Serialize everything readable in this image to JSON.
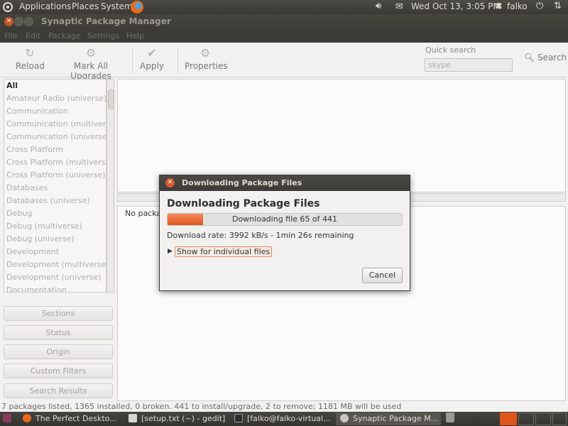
{
  "top_panel": {
    "menus": [
      "Applications",
      "Places",
      "System"
    ],
    "datetime": "Wed Oct 13,  3:05 PM",
    "user": "falko"
  },
  "window": {
    "title": "Synaptic Package Manager",
    "menus": [
      "File",
      "Edit",
      "Package",
      "Settings",
      "Help"
    ]
  },
  "toolbar": {
    "reload": "Reload",
    "mark_all": "Mark All Upgrades",
    "apply": "Apply",
    "properties": "Properties",
    "quick_search_label": "Quick search",
    "quick_search_value": "skype",
    "search": "Search"
  },
  "sidebar": {
    "categories": [
      "All",
      "Amateur Radio (universe)",
      "Communication",
      "Communication (multiverse)",
      "Communication (universe)",
      "Cross Platform",
      "Cross Platform (multiverse)",
      "Cross Platform (universe)",
      "Databases",
      "Databases (universe)",
      "Debug",
      "Debug (multiverse)",
      "Debug (universe)",
      "Development",
      "Development (multiverse)",
      "Development (universe)",
      "Documentation"
    ],
    "selected": "All",
    "filters": [
      "Sections",
      "Status",
      "Origin",
      "Custom Filters",
      "Search Results"
    ]
  },
  "description": {
    "text": "No package is selected."
  },
  "status_bar": "7 packages listed, 1365 installed, 0 broken. 441 to install/upgrade, 2 to remove; 1181 MB will be used",
  "dialog": {
    "title": "Downloading Package Files",
    "heading": "Downloading Package Files",
    "progress_text": "Downloading file 65 of 441",
    "progress_fraction": 0.15,
    "rate": "Download rate: 3992 kB/s - 1min 26s remaining",
    "expander": "Show for individual files",
    "cancel": "Cancel"
  },
  "taskbar": {
    "tasks": [
      "The Perfect Deskto...",
      "[setup.txt (~) - gedit]",
      "[falko@falko-virtual...",
      "Synaptic Package M..."
    ]
  },
  "colors": {
    "accent": "#e0561c",
    "panel": "#3c3b37",
    "close": "#d55a30"
  }
}
